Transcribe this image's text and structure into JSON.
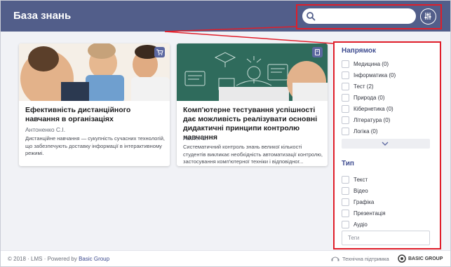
{
  "header": {
    "title": "База знань",
    "search_placeholder": "",
    "search_icon": "search-icon",
    "filter_icon": "sliders-icon"
  },
  "cards": [
    {
      "title": "Ефективність дистанційного навчання в організаціях",
      "author": "Антоненко С.І.",
      "description": "Дистанційне навчання — сукупність сучасних технологій, що забезпечують доставку інформації в інтерактивному режимі.",
      "badge_icon": "cart-icon"
    },
    {
      "title": "Комп'ютерне тестування успішності дає можливість реалізувати основні дидактичні принципи контролю навчання",
      "author": "Author B.",
      "description": "Систематичний контроль знань великої кількості студентів викликає необхідність автоматизації контролю, застосування комп'ютерної техніки і відповідног...",
      "badge_icon": "book-icon"
    }
  ],
  "sidebar": {
    "direction_title": "Напрямок",
    "directions": [
      "Медицина (0)",
      "Інформатика (0)",
      "Тест (2)",
      "Природа (0)",
      "Кібернетика (0)",
      "Література (0)",
      "Логіка (0)"
    ],
    "type_title": "Тип",
    "types": [
      "Текст",
      "Відео",
      "Графіка",
      "Презентація",
      "Аудіо"
    ],
    "tags_placeholder": "Теги"
  },
  "footer": {
    "copyright": "© 2018 · LMS · Powered by ",
    "company": "Basic Group",
    "support": "Технічна підтримка",
    "logo_text": "BASIC GROUP"
  },
  "colors": {
    "header_bg": "#525e8a",
    "accent": "#3d4b8f",
    "highlight": "#e01e2a"
  }
}
